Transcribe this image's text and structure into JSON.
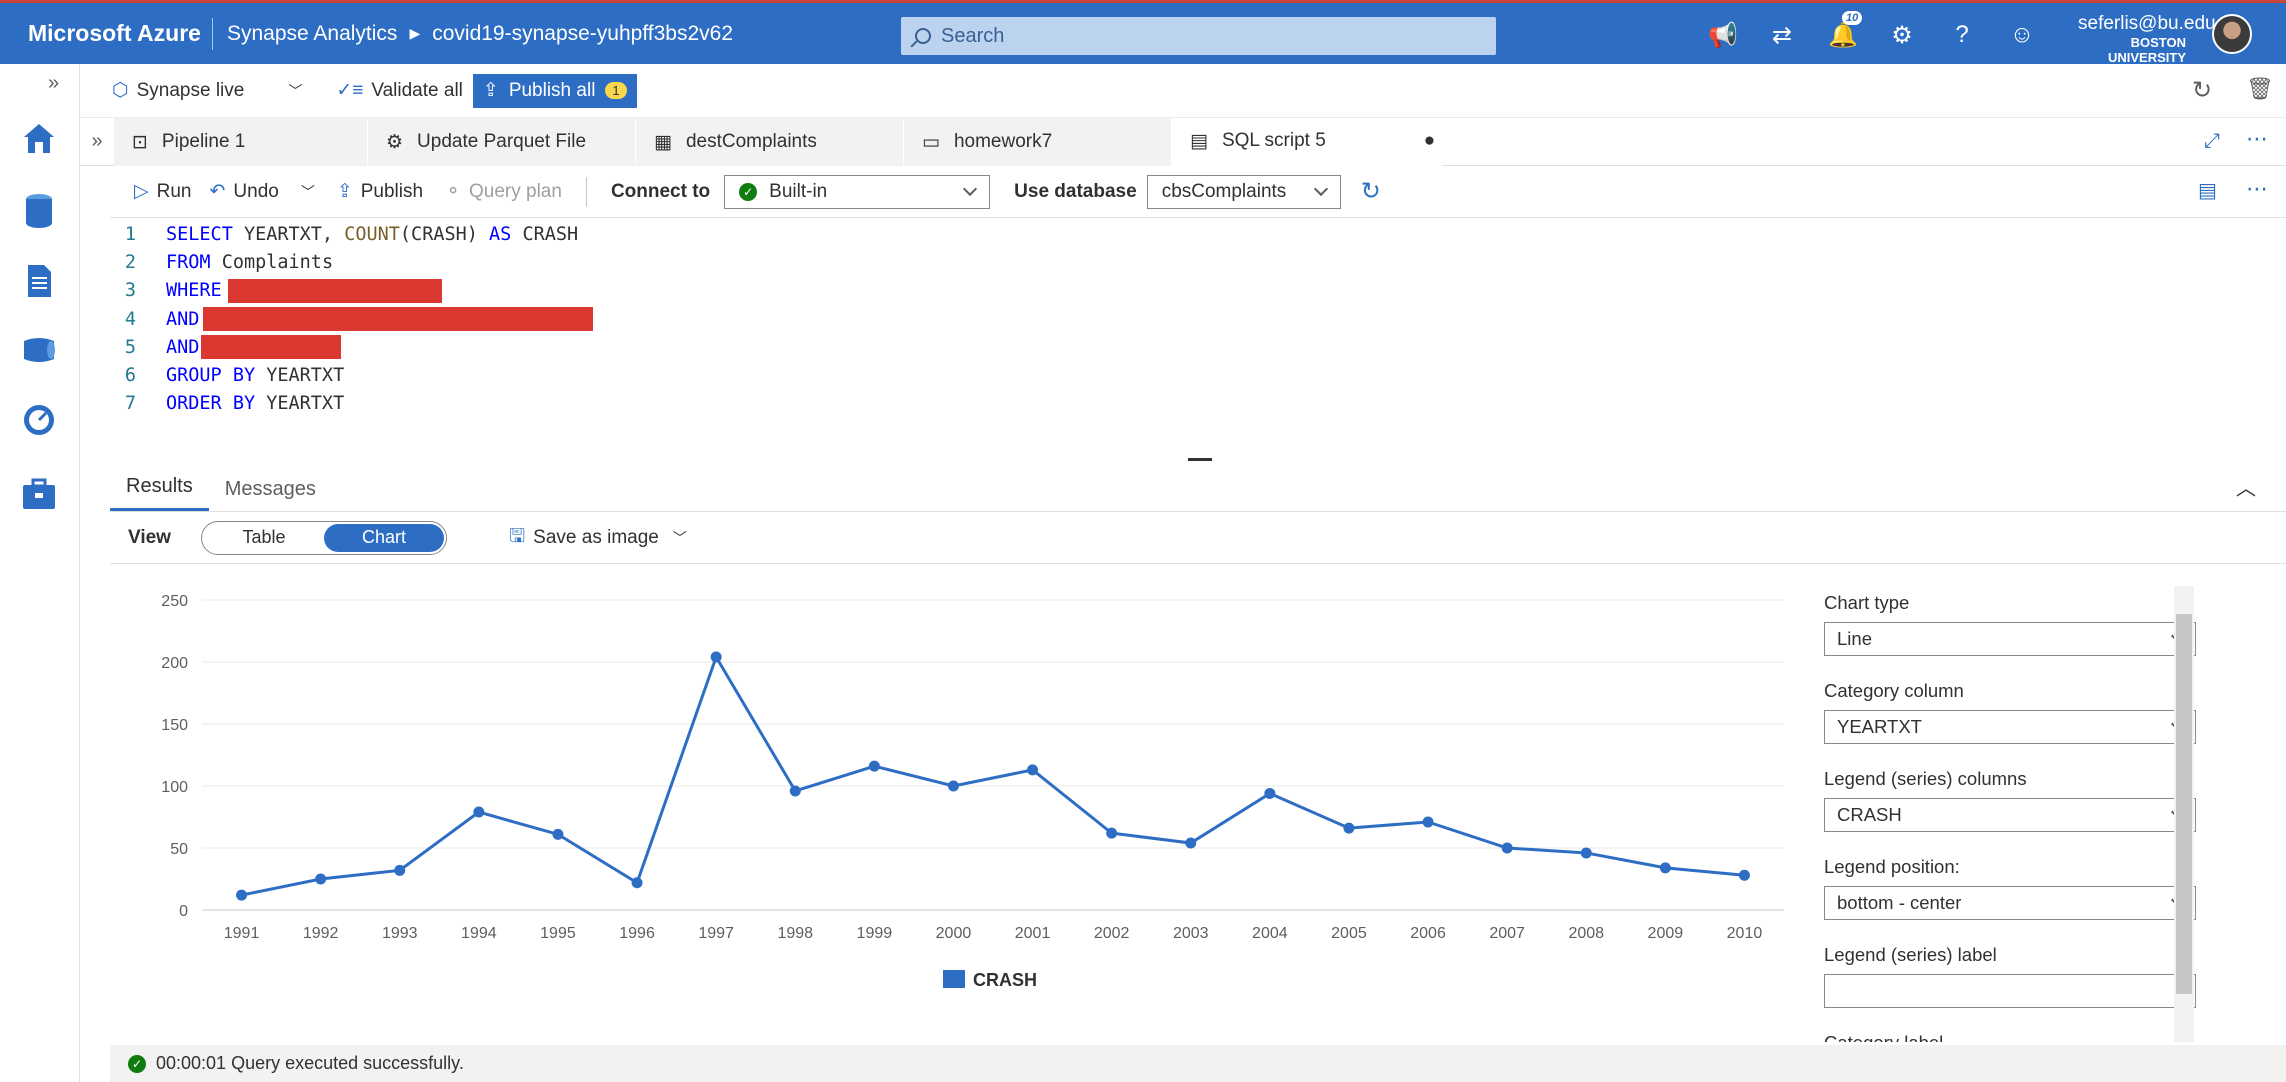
{
  "topbar": {
    "brand": "Microsoft Azure",
    "product": "Synapse Analytics",
    "workspace": "covid19-synapse-yuhpff3bs2v62",
    "search_placeholder": "Search",
    "notifications_count": "10",
    "user_email": "seferlis@bu.edu",
    "user_org": "BOSTON UNIVERSITY"
  },
  "cmdbar": {
    "mode": "Synapse live",
    "validate": "Validate all",
    "publish_all": "Publish all",
    "publish_count": "1"
  },
  "tabs": [
    {
      "label": "Pipeline 1",
      "icon": "pipeline-icon"
    },
    {
      "label": "Update Parquet File",
      "icon": "dataflow-icon"
    },
    {
      "label": "destComplaints",
      "icon": "table-icon"
    },
    {
      "label": "homework7",
      "icon": "notebook-icon"
    },
    {
      "label": "SQL script 5",
      "icon": "sql-script-icon",
      "unsaved": "●"
    }
  ],
  "editbar": {
    "run": "Run",
    "undo": "Undo",
    "publish": "Publish",
    "query_plan": "Query plan",
    "connect_to_label": "Connect to",
    "connect_to_value": "Built-in",
    "use_db_label": "Use database",
    "use_db_value": "cbsComplaints"
  },
  "code": {
    "l1_kw1": "SELECT",
    "l1_a": " YEARTXT, ",
    "l1_fn": "COUNT",
    "l1_b": "(CRASH) ",
    "l1_kw2": "AS",
    "l1_c": " CRASH",
    "l2_kw": "FROM",
    "l2_a": " Complaints",
    "l3_kw": "WHERE",
    "l4_kw": "AND",
    "l5_kw": "AND",
    "l6_kw": "GROUP BY",
    "l6_a": " YEARTXT",
    "l7_kw": "ORDER BY",
    "l7_a": " YEARTXT"
  },
  "results": {
    "tab_results": "Results",
    "tab_messages": "Messages",
    "view_label": "View",
    "toggle_table": "Table",
    "toggle_chart": "Chart",
    "save_as_image": "Save as image"
  },
  "chart_data": {
    "type": "line",
    "categories": [
      "1991",
      "1992",
      "1993",
      "1994",
      "1995",
      "1996",
      "1997",
      "1998",
      "1999",
      "2000",
      "2001",
      "2002",
      "2003",
      "2004",
      "2005",
      "2006",
      "2007",
      "2008",
      "2009",
      "2010"
    ],
    "series": [
      {
        "name": "CRASH",
        "values": [
          12,
          25,
          32,
          79,
          61,
          22,
          204,
          96,
          116,
          100,
          113,
          62,
          54,
          94,
          66,
          71,
          50,
          46,
          34,
          28
        ],
        "color": "#2d6ec4"
      }
    ],
    "yticks": [
      0,
      50,
      100,
      150,
      200,
      250
    ],
    "ylim": [
      0,
      250
    ],
    "grid": true,
    "legend": "bottom-center"
  },
  "panel": {
    "chart_type_label": "Chart type",
    "chart_type_value": "Line",
    "category_col_label": "Category column",
    "category_col_value": "YEARTXT",
    "legend_cols_label": "Legend (series) columns",
    "legend_cols_value": "CRASH",
    "legend_pos_label": "Legend position:",
    "legend_pos_value": "bottom - center",
    "legend_label_label": "Legend (series) label",
    "category_label_label": "Category label"
  },
  "status": {
    "text": "00:00:01 Query executed successfully."
  }
}
